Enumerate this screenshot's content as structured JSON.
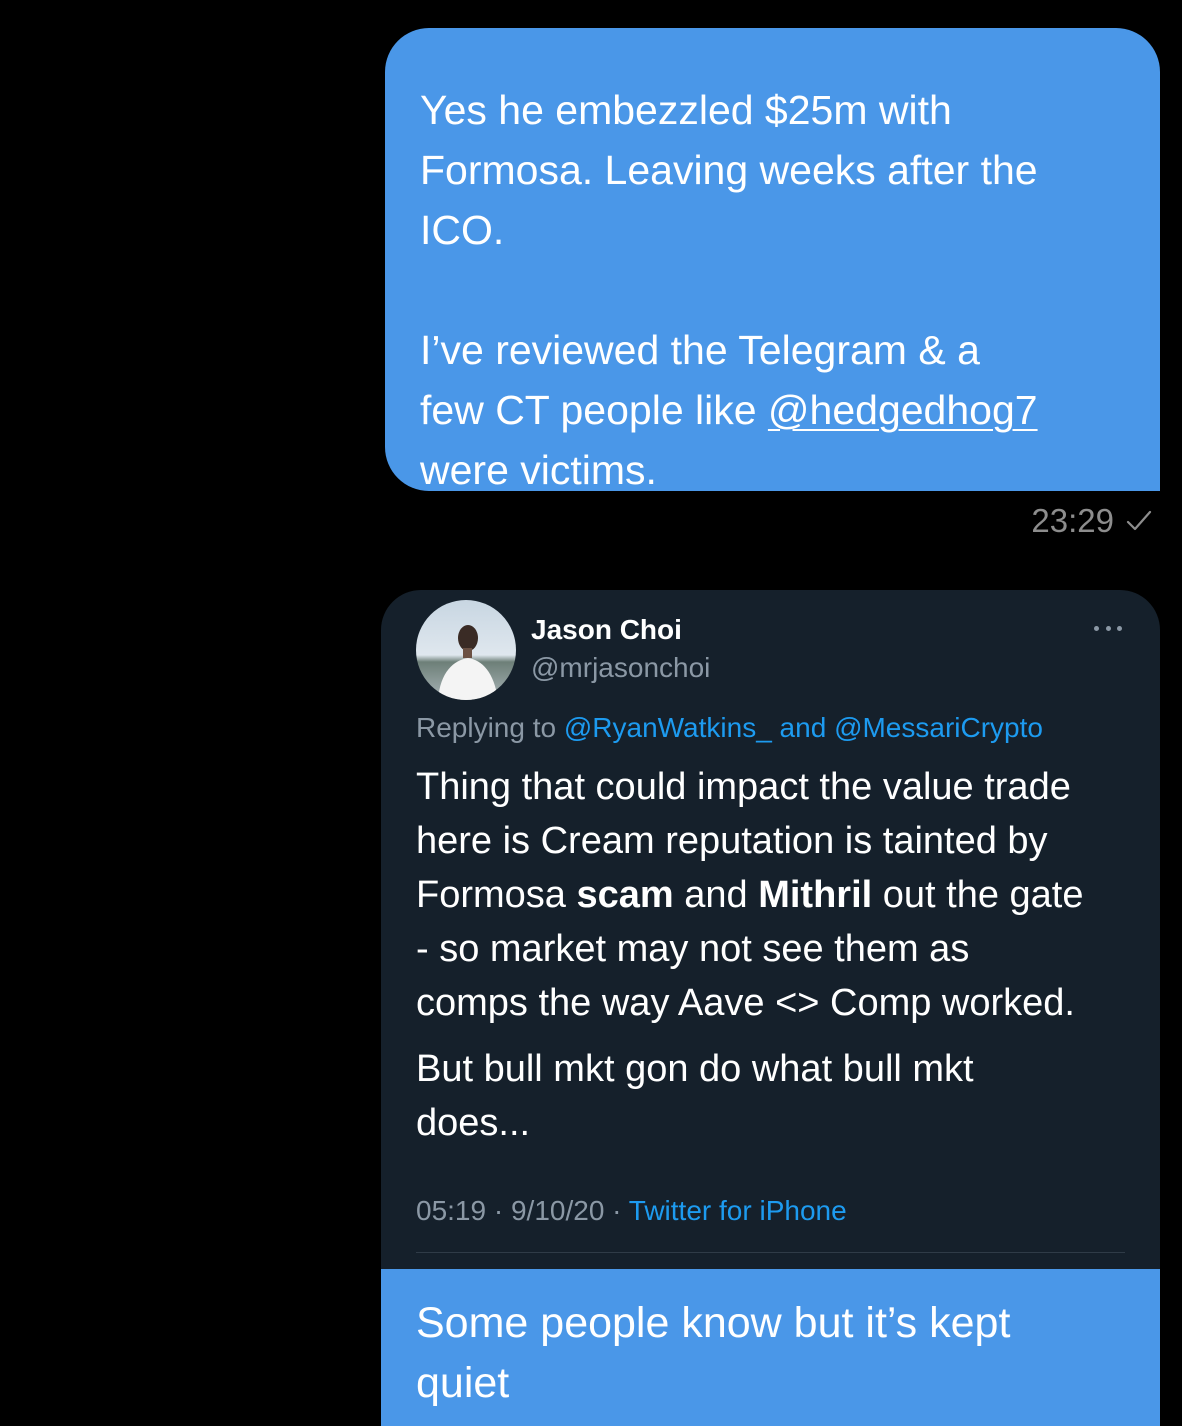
{
  "messages": {
    "outgoing_1": {
      "line1": "Yes he embezzled $25m with",
      "line2": "Formosa. Leaving weeks after the",
      "line3": "ICO.",
      "line4": "I’ve reviewed the Telegram & a",
      "line5_prefix": "few CT people like ",
      "mention": "@hedgedhog7",
      "line6": "were victims.",
      "time": "23:29"
    },
    "outgoing_2": {
      "line1": "Some people know but it’s kept",
      "line2": "quiet"
    }
  },
  "tweet": {
    "author_name": "Jason Choi",
    "author_handle": "@mrjasonchoi",
    "replying_label": "Replying to ",
    "reply_mention_1": "@RyanWatkins_",
    "reply_and": " and ",
    "reply_mention_2": "@MessariCrypto",
    "body_line1": "Thing that could impact the value trade",
    "body_line2": "here is Cream reputation is tainted by",
    "body_line3_a": "Formosa ",
    "body_line3_b": "scam",
    "body_line3_c": " and ",
    "body_line3_d": "Mithril",
    "body_line3_e": " out the gate",
    "body_line4": "- so market may not see them as",
    "body_line5": "comps the way Aave <> Comp worked.",
    "body_p2_line1": "But bull mkt gon do what bull mkt",
    "body_p2_line2": "does...",
    "time": "05:19",
    "date": "9/10/20",
    "separator": " · ",
    "source": "Twitter for iPhone"
  },
  "icons": {
    "read_tick": "checkmark-icon",
    "more": "more-horizontal-icon",
    "avatar": "user-avatar"
  },
  "colors": {
    "bubble_blue": "#4a97e8",
    "tweet_bg": "#15202b",
    "tweet_link": "#1d9bf0",
    "muted": "#8b98a5"
  }
}
